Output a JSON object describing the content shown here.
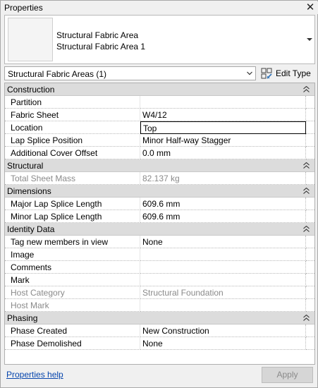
{
  "window": {
    "title": "Properties",
    "close_glyph": "✕"
  },
  "type_selector": {
    "family": "Structural Fabric Area",
    "type": "Structural Fabric Area 1"
  },
  "filter": {
    "label": "Structural Fabric Areas (1)"
  },
  "edit_type": {
    "label": "Edit Type",
    "icon": "edit-type-icon"
  },
  "groups": [
    {
      "id": "construction",
      "label": "Construction",
      "rows": [
        {
          "name": "Partition",
          "value": ""
        },
        {
          "name": "Fabric Sheet",
          "value": "W4/12"
        },
        {
          "name": "Location",
          "value": "Top",
          "editing": true
        },
        {
          "name": "Lap Splice Position",
          "value": "Minor Half-way Stagger"
        },
        {
          "name": "Additional Cover Offset",
          "value": "0.0 mm"
        }
      ]
    },
    {
      "id": "structural",
      "label": "Structural",
      "rows": [
        {
          "name": "Total Sheet Mass",
          "value": "82.137 kg",
          "disabled": true
        }
      ]
    },
    {
      "id": "dimensions",
      "label": "Dimensions",
      "rows": [
        {
          "name": "Major Lap Splice Length",
          "value": "609.6 mm"
        },
        {
          "name": "Minor Lap Splice Length",
          "value": "609.6 mm"
        }
      ]
    },
    {
      "id": "identity-data",
      "label": "Identity Data",
      "rows": [
        {
          "name": "Tag new members in view",
          "value": "None"
        },
        {
          "name": "Image",
          "value": ""
        },
        {
          "name": "Comments",
          "value": ""
        },
        {
          "name": "Mark",
          "value": ""
        },
        {
          "name": "Host Category",
          "value": "Structural Foundation",
          "disabled": true
        },
        {
          "name": "Host Mark",
          "value": "",
          "disabled": true
        }
      ]
    },
    {
      "id": "phasing",
      "label": "Phasing",
      "rows": [
        {
          "name": "Phase Created",
          "value": "New Construction"
        },
        {
          "name": "Phase Demolished",
          "value": "None"
        }
      ]
    }
  ],
  "footer": {
    "help_link": "Properties help",
    "apply_label": "Apply"
  },
  "colors": {
    "group_header": "#dcdcdc",
    "disabled_text": "#8a8a8a",
    "link": "#0645ad"
  }
}
